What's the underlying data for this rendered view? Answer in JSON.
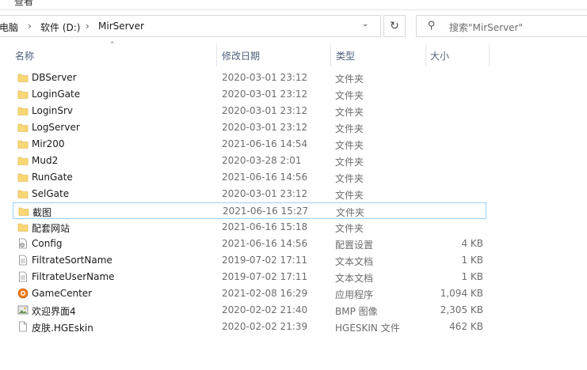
{
  "ribbon": {
    "view_label": "查看"
  },
  "address": {
    "crumbs": [
      "电脑",
      "软件 (D:)",
      "MirServer"
    ]
  },
  "search": {
    "placeholder": "搜索\"MirServer\""
  },
  "columns": {
    "name": "名称",
    "date": "修改日期",
    "type": "类型",
    "size": "大小"
  },
  "files": [
    {
      "name": "DBServer",
      "date": "2020-03-01 23:12",
      "type": "文件夹",
      "size": "",
      "icon": "folder-icon"
    },
    {
      "name": "LoginGate",
      "date": "2020-03-01 23:12",
      "type": "文件夹",
      "size": "",
      "icon": "folder-icon"
    },
    {
      "name": "LoginSrv",
      "date": "2020-03-01 23:12",
      "type": "文件夹",
      "size": "",
      "icon": "folder-icon"
    },
    {
      "name": "LogServer",
      "date": "2020-03-01 23:12",
      "type": "文件夹",
      "size": "",
      "icon": "folder-icon"
    },
    {
      "name": "Mir200",
      "date": "2021-06-16 14:54",
      "type": "文件夹",
      "size": "",
      "icon": "folder-icon"
    },
    {
      "name": "Mud2",
      "date": "2020-03-28 2:01",
      "type": "文件夹",
      "size": "",
      "icon": "folder-icon"
    },
    {
      "name": "RunGate",
      "date": "2021-06-16 14:56",
      "type": "文件夹",
      "size": "",
      "icon": "folder-icon"
    },
    {
      "name": "SelGate",
      "date": "2020-03-01 23:12",
      "type": "文件夹",
      "size": "",
      "icon": "folder-icon"
    },
    {
      "name": "截图",
      "date": "2021-06-16 15:27",
      "type": "文件夹",
      "size": "",
      "icon": "folder-icon"
    },
    {
      "name": "配套网站",
      "date": "2021-06-16 15:18",
      "type": "文件夹",
      "size": "",
      "icon": "folder-icon"
    },
    {
      "name": "Config",
      "date": "2021-06-16 14:56",
      "type": "配置设置",
      "size": "4 KB",
      "icon": "config-file-icon"
    },
    {
      "name": "FiltrateSortName",
      "date": "2019-07-02 17:11",
      "type": "文本文档",
      "size": "1 KB",
      "icon": "text-file-icon"
    },
    {
      "name": "FiltrateUserName",
      "date": "2019-07-02 17:11",
      "type": "文本文档",
      "size": "1 KB",
      "icon": "text-file-icon"
    },
    {
      "name": "GameCenter",
      "date": "2021-02-08 16:29",
      "type": "应用程序",
      "size": "1,094 KB",
      "icon": "app-icon"
    },
    {
      "name": "欢迎界面4",
      "date": "2020-02-02 21:40",
      "type": "BMP 图像",
      "size": "2,305 KB",
      "icon": "bmp-image-icon"
    },
    {
      "name": "皮肤.HGEskin",
      "date": "2020-02-02 21:39",
      "type": "HGESKIN 文件",
      "size": "462 KB",
      "icon": "blank-file-icon"
    }
  ],
  "colors": {
    "folder": "#f8d775",
    "focus_border": "#99d1ff",
    "header_text": "#4c607a"
  }
}
